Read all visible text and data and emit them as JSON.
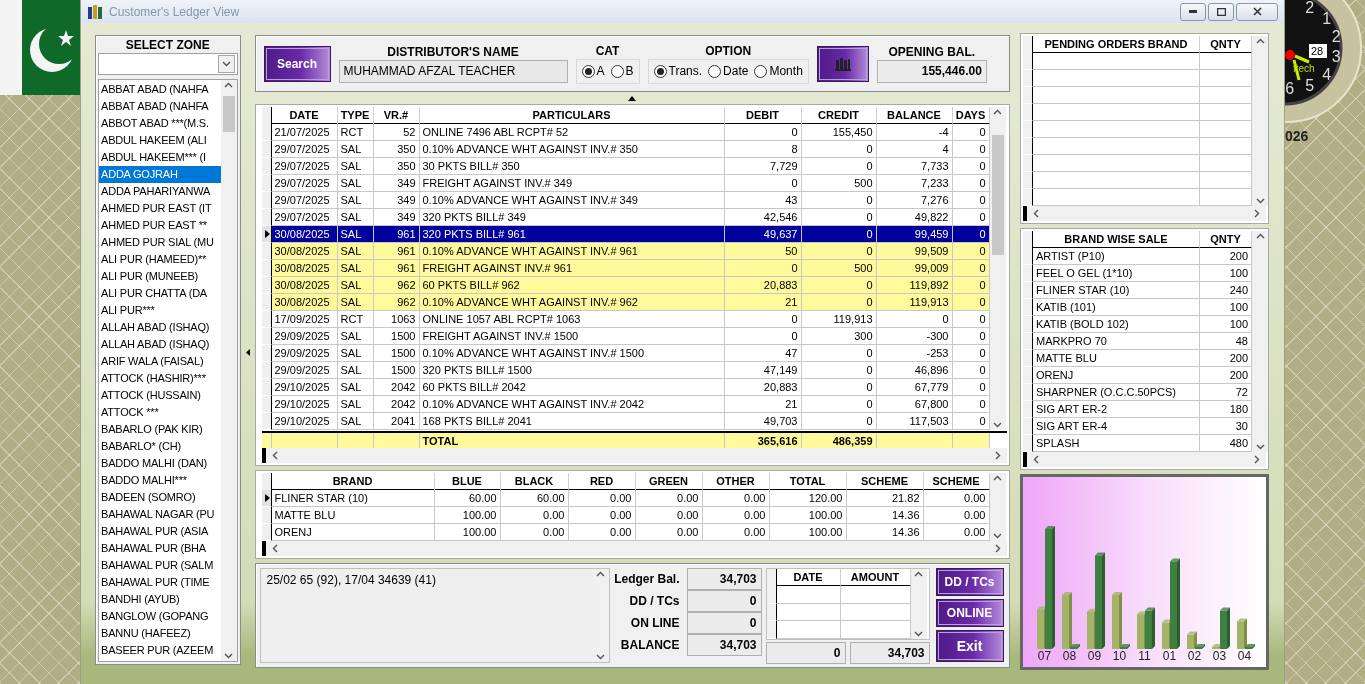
{
  "window": {
    "title": "Customer's Ledger View"
  },
  "clock": {
    "numerals": [
      "2",
      "1",
      "2",
      "3",
      "4",
      "5",
      "6"
    ],
    "date": "28",
    "maker": "ftech",
    "year": "026"
  },
  "zone": {
    "title": "SELECT ZONE",
    "items": [
      {
        "label": "ABBAT ABAD (NAHFA",
        "selected": false
      },
      {
        "label": "ABBAT ABAD (NAHFA",
        "selected": false
      },
      {
        "label": "ABBOT ABAD ***(M.S.",
        "selected": false
      },
      {
        "label": "ABDUL HAKEEM (ALI",
        "selected": false
      },
      {
        "label": "ABDUL HAKEEM*** (I",
        "selected": false
      },
      {
        "label": "ADDA GOJRAH",
        "selected": true
      },
      {
        "label": "ADDA PAHARIYANWA",
        "selected": false
      },
      {
        "label": "AHMED PUR EAST (IT",
        "selected": false
      },
      {
        "label": "AHMED PUR EAST **",
        "selected": false
      },
      {
        "label": "AHMED PUR SIAL (MU",
        "selected": false
      },
      {
        "label": "ALI PUR (HAMEED)**",
        "selected": false
      },
      {
        "label": "ALI PUR (MUNEEB)",
        "selected": false
      },
      {
        "label": "ALI PUR CHATTA (DA",
        "selected": false
      },
      {
        "label": "ALI PUR***",
        "selected": false
      },
      {
        "label": "ALLAH ABAD (ISHAQ)",
        "selected": false
      },
      {
        "label": "ALLAH ABAD (ISHAQ)",
        "selected": false
      },
      {
        "label": "ARIF WALA (FAISAL)",
        "selected": false
      },
      {
        "label": "ATTOCK (HASHIR)***",
        "selected": false
      },
      {
        "label": "ATTOCK (HUSSAIN)",
        "selected": false
      },
      {
        "label": "ATTOCK ***",
        "selected": false
      },
      {
        "label": "BABARLO (PAK KIR)",
        "selected": false
      },
      {
        "label": "BABARLO* (CH)",
        "selected": false
      },
      {
        "label": "BADDO MALHI (DAN)",
        "selected": false
      },
      {
        "label": "BADDO MALHI***",
        "selected": false
      },
      {
        "label": "BADEEN (SOMRO)",
        "selected": false
      },
      {
        "label": "BAHAWAL NAGAR (PU",
        "selected": false
      },
      {
        "label": "BAHAWAL PUR (ASIA",
        "selected": false
      },
      {
        "label": "BAHAWAL PUR (BHA",
        "selected": false
      },
      {
        "label": "BAHAWAL PUR (SALM",
        "selected": false
      },
      {
        "label": "BAHAWAL PUR (TIME",
        "selected": false
      },
      {
        "label": "BANDHI (AYUB)",
        "selected": false
      },
      {
        "label": "BANGLOW (GOPANG",
        "selected": false
      },
      {
        "label": "BANNU (HAFEEZ)",
        "selected": false
      },
      {
        "label": "BASEER PUR (AZEEM",
        "selected": false
      }
    ]
  },
  "header": {
    "search_button": "Search",
    "distributor_label": "DISTRIBUTOR'S NAME",
    "distributor_name": "MUHAMMAD AFZAL TEACHER",
    "cat_label": "CAT",
    "cat_options": [
      {
        "label": "A",
        "selected": true
      },
      {
        "label": "B",
        "selected": false
      }
    ],
    "option_label": "OPTION",
    "options": [
      {
        "label": "Trans.",
        "selected": true
      },
      {
        "label": "Date",
        "selected": false
      },
      {
        "label": "Month",
        "selected": false
      }
    ],
    "opening_label": "OPENING BAL.",
    "opening_balance": "155,446.00"
  },
  "ledger": {
    "columns": [
      "DATE",
      "TYPE",
      "VR.#",
      "PARTICULARS",
      "DEBIT",
      "CREDIT",
      "BALANCE",
      "DAYS"
    ],
    "rows": [
      {
        "cells": [
          "21/07/2025",
          "RCT",
          "52",
          "ONLINE 7496 ABL RCPT# 52",
          "0",
          "155,450",
          "-4",
          "0"
        ],
        "selected": false,
        "highlighted": false
      },
      {
        "cells": [
          "29/07/2025",
          "SAL",
          "350",
          "0.10% ADVANCE WHT AGAINST INV.# 350",
          "8",
          "0",
          "4",
          "0"
        ],
        "selected": false,
        "highlighted": false
      },
      {
        "cells": [
          "29/07/2025",
          "SAL",
          "350",
          "30 PKTS  BILL# 350",
          "7,729",
          "0",
          "7,733",
          "0"
        ],
        "selected": false,
        "highlighted": false
      },
      {
        "cells": [
          "29/07/2025",
          "SAL",
          "349",
          "FREIGHT AGAINST INV.# 349",
          "0",
          "500",
          "7,233",
          "0"
        ],
        "selected": false,
        "highlighted": false
      },
      {
        "cells": [
          "29/07/2025",
          "SAL",
          "349",
          "0.10% ADVANCE WHT AGAINST INV.# 349",
          "43",
          "0",
          "7,276",
          "0"
        ],
        "selected": false,
        "highlighted": false
      },
      {
        "cells": [
          "29/07/2025",
          "SAL",
          "349",
          "320 PKTS  BILL# 349",
          "42,546",
          "0",
          "49,822",
          "0"
        ],
        "selected": false,
        "highlighted": false
      },
      {
        "cells": [
          "30/08/2025",
          "SAL",
          "961",
          "320 PKTS  BILL# 961",
          "49,637",
          "0",
          "99,459",
          "0"
        ],
        "selected": true,
        "highlighted": true
      },
      {
        "cells": [
          "30/08/2025",
          "SAL",
          "961",
          "0.10% ADVANCE WHT AGAINST INV.# 961",
          "50",
          "0",
          "99,509",
          "0"
        ],
        "selected": false,
        "highlighted": true
      },
      {
        "cells": [
          "30/08/2025",
          "SAL",
          "961",
          "FREIGHT AGAINST INV.# 961",
          "0",
          "500",
          "99,009",
          "0"
        ],
        "selected": false,
        "highlighted": true
      },
      {
        "cells": [
          "30/08/2025",
          "SAL",
          "962",
          "60 PKTS  BILL# 962",
          "20,883",
          "0",
          "119,892",
          "0"
        ],
        "selected": false,
        "highlighted": true
      },
      {
        "cells": [
          "30/08/2025",
          "SAL",
          "962",
          "0.10% ADVANCE WHT AGAINST INV.# 962",
          "21",
          "0",
          "119,913",
          "0"
        ],
        "selected": false,
        "highlighted": true
      },
      {
        "cells": [
          "17/09/2025",
          "RCT",
          "1063",
          "ONLINE 1057 ABL RCPT# 1063",
          "0",
          "119,913",
          "0",
          "0"
        ],
        "selected": false,
        "highlighted": false
      },
      {
        "cells": [
          "29/09/2025",
          "SAL",
          "1500",
          "FREIGHT AGAINST INV.# 1500",
          "0",
          "300",
          "-300",
          "0"
        ],
        "selected": false,
        "highlighted": false
      },
      {
        "cells": [
          "29/09/2025",
          "SAL",
          "1500",
          "0.10% ADVANCE WHT AGAINST INV.# 1500",
          "47",
          "0",
          "-253",
          "0"
        ],
        "selected": false,
        "highlighted": false
      },
      {
        "cells": [
          "29/09/2025",
          "SAL",
          "1500",
          "320 PKTS  BILL# 1500",
          "47,149",
          "0",
          "46,896",
          "0"
        ],
        "selected": false,
        "highlighted": false
      },
      {
        "cells": [
          "29/10/2025",
          "SAL",
          "2042",
          "60 PKTS  BILL# 2042",
          "20,883",
          "0",
          "67,779",
          "0"
        ],
        "selected": false,
        "highlighted": false
      },
      {
        "cells": [
          "29/10/2025",
          "SAL",
          "2042",
          "0.10% ADVANCE WHT AGAINST INV.# 2042",
          "21",
          "0",
          "67,800",
          "0"
        ],
        "selected": false,
        "highlighted": false
      },
      {
        "cells": [
          "29/10/2025",
          "SAL",
          "2041",
          "168 PKTS  BILL# 2041",
          "49,703",
          "0",
          "117,503",
          "0"
        ],
        "selected": false,
        "highlighted": false
      }
    ],
    "total": {
      "label": "TOTAL",
      "debit": "365,616",
      "credit": "486,359"
    }
  },
  "brands": {
    "columns": [
      "BRAND",
      "BLUE",
      "BLACK",
      "RED",
      "GREEN",
      "OTHER",
      "TOTAL",
      "SCHEME",
      "SCHEME"
    ],
    "rows": [
      {
        "cells": [
          "FLINER STAR (10)",
          "60.00",
          "60.00",
          "0.00",
          "0.00",
          "0.00",
          "120.00",
          "21.82",
          "0.00"
        ],
        "selected": true
      },
      {
        "cells": [
          "MATTE BLU",
          "100.00",
          "0.00",
          "0.00",
          "0.00",
          "0.00",
          "100.00",
          "14.36",
          "0.00"
        ],
        "selected": false
      },
      {
        "cells": [
          "ORENJ",
          "100.00",
          "0.00",
          "0.00",
          "0.00",
          "0.00",
          "100.00",
          "14.36",
          "0.00"
        ],
        "selected": false
      }
    ]
  },
  "notes": "25/02 65 (92), 17/04 34639 (41)",
  "summary": [
    {
      "label": "Ledger Bal.",
      "value": "34,703"
    },
    {
      "label": "DD / TCs",
      "value": "0"
    },
    {
      "label": "ON LINE",
      "value": "0"
    },
    {
      "label": "BALANCE",
      "value": "34,703"
    }
  ],
  "dd_table": {
    "columns": [
      "DATE",
      "AMOUNT"
    ],
    "totals": [
      "0",
      "34,703"
    ]
  },
  "buttons": [
    "DD / TCs",
    "ONLINE",
    "Exit"
  ],
  "pending": {
    "columns": [
      "PENDING ORDERS BRAND",
      "QNTY"
    ]
  },
  "brand_sale": {
    "columns": [
      "BRAND WISE SALE",
      "QNTY"
    ],
    "rows": [
      [
        "ARTIST (P10)",
        "200"
      ],
      [
        "FEEL O GEL (1*10)",
        "100"
      ],
      [
        "FLINER STAR (10)",
        "240"
      ],
      [
        "KATIB (101)",
        "100"
      ],
      [
        "KATIB (BOLD 102)",
        "100"
      ],
      [
        "MARKPRO 70",
        "48"
      ],
      [
        "MATTE BLU",
        "200"
      ],
      [
        "ORENJ",
        "200"
      ],
      [
        "SHARPNER (O.C.C.50PCS)",
        "72"
      ],
      [
        "SIG ART ER-2",
        "180"
      ],
      [
        "SIG ART ER-4",
        "30"
      ],
      [
        "SPLASH",
        "480"
      ]
    ]
  },
  "sales_chart": {
    "months": [
      "07",
      "08",
      "09",
      "10",
      "11",
      "01",
      "02",
      "03",
      "04"
    ]
  }
}
